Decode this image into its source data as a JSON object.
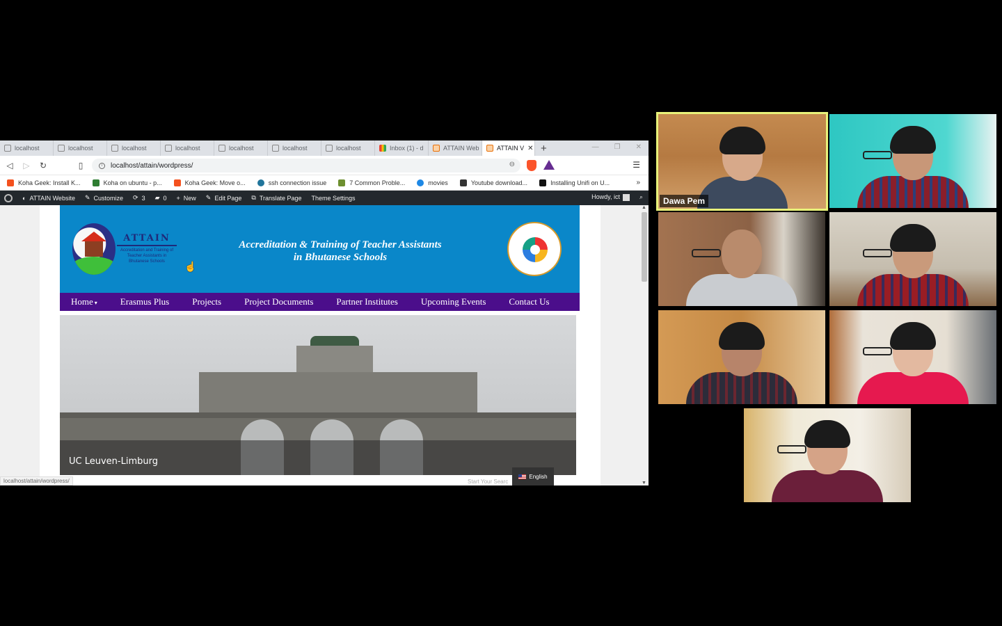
{
  "browser": {
    "tabs": [
      {
        "label": "localhost",
        "icon": "xampp-icon"
      },
      {
        "label": "localhost",
        "icon": "xampp-icon"
      },
      {
        "label": "localhost",
        "icon": "xampp-icon"
      },
      {
        "label": "localhost",
        "icon": "xampp-icon"
      },
      {
        "label": "localhost",
        "icon": "xampp-icon"
      },
      {
        "label": "localhost",
        "icon": "xampp-icon"
      },
      {
        "label": "localhost",
        "icon": "xampp-icon"
      },
      {
        "label": "Inbox (1) - d",
        "icon": "gmail-icon"
      },
      {
        "label": "ATTAIN Web",
        "icon": "xampp-icon"
      },
      {
        "label": "ATTAIN V",
        "icon": "xampp-icon",
        "active": true
      }
    ],
    "newtab": "+",
    "url": "localhost/attain/wordpress/",
    "bookmarks": [
      {
        "label": "Koha Geek: Install K...",
        "color": "#f4511e"
      },
      {
        "label": "Koha on ubuntu - p...",
        "color": "#2e7d32"
      },
      {
        "label": "Koha Geek: Move o...",
        "color": "#f4511e"
      },
      {
        "label": "ssh connection issue",
        "color": "#21759b"
      },
      {
        "label": "7 Common Proble...",
        "color": "#6d8f2f"
      },
      {
        "label": "movies",
        "color": "#1e88e5"
      },
      {
        "label": "Youtube download...",
        "color": "#333333"
      },
      {
        "label": "Installing Unifi on U...",
        "color": "#111111"
      }
    ],
    "bookmarks_more": "»",
    "status_url": "localhost/attain/wordpress/"
  },
  "wpadmin": {
    "site": "ATTAIN Website",
    "customize": "Customize",
    "updates": "3",
    "comments": "0",
    "new": "New",
    "edit": "Edit Page",
    "translate": "Translate Page",
    "theme": "Theme Settings",
    "howdy": "Howdy, ict"
  },
  "site": {
    "logo_title": "ATTAIN",
    "logo_sub": "Accreditation and Training of Teacher Assistants in Bhutanese Schools",
    "title_line1": "Accreditation & Training of Teacher Assistants",
    "title_line2": "in Bhutanese Schools",
    "nav": [
      "Home",
      "Erasmus Plus",
      "Projects",
      "Project Documents",
      "Partner Institutes",
      "Upcoming Events",
      "Contact Us"
    ],
    "slide_caption": "UC Leuven-Limburg",
    "language": "English",
    "search_placeholder": "Start Your Searc"
  },
  "participants": [
    {
      "name": "Dawa Pem",
      "active": true
    }
  ]
}
